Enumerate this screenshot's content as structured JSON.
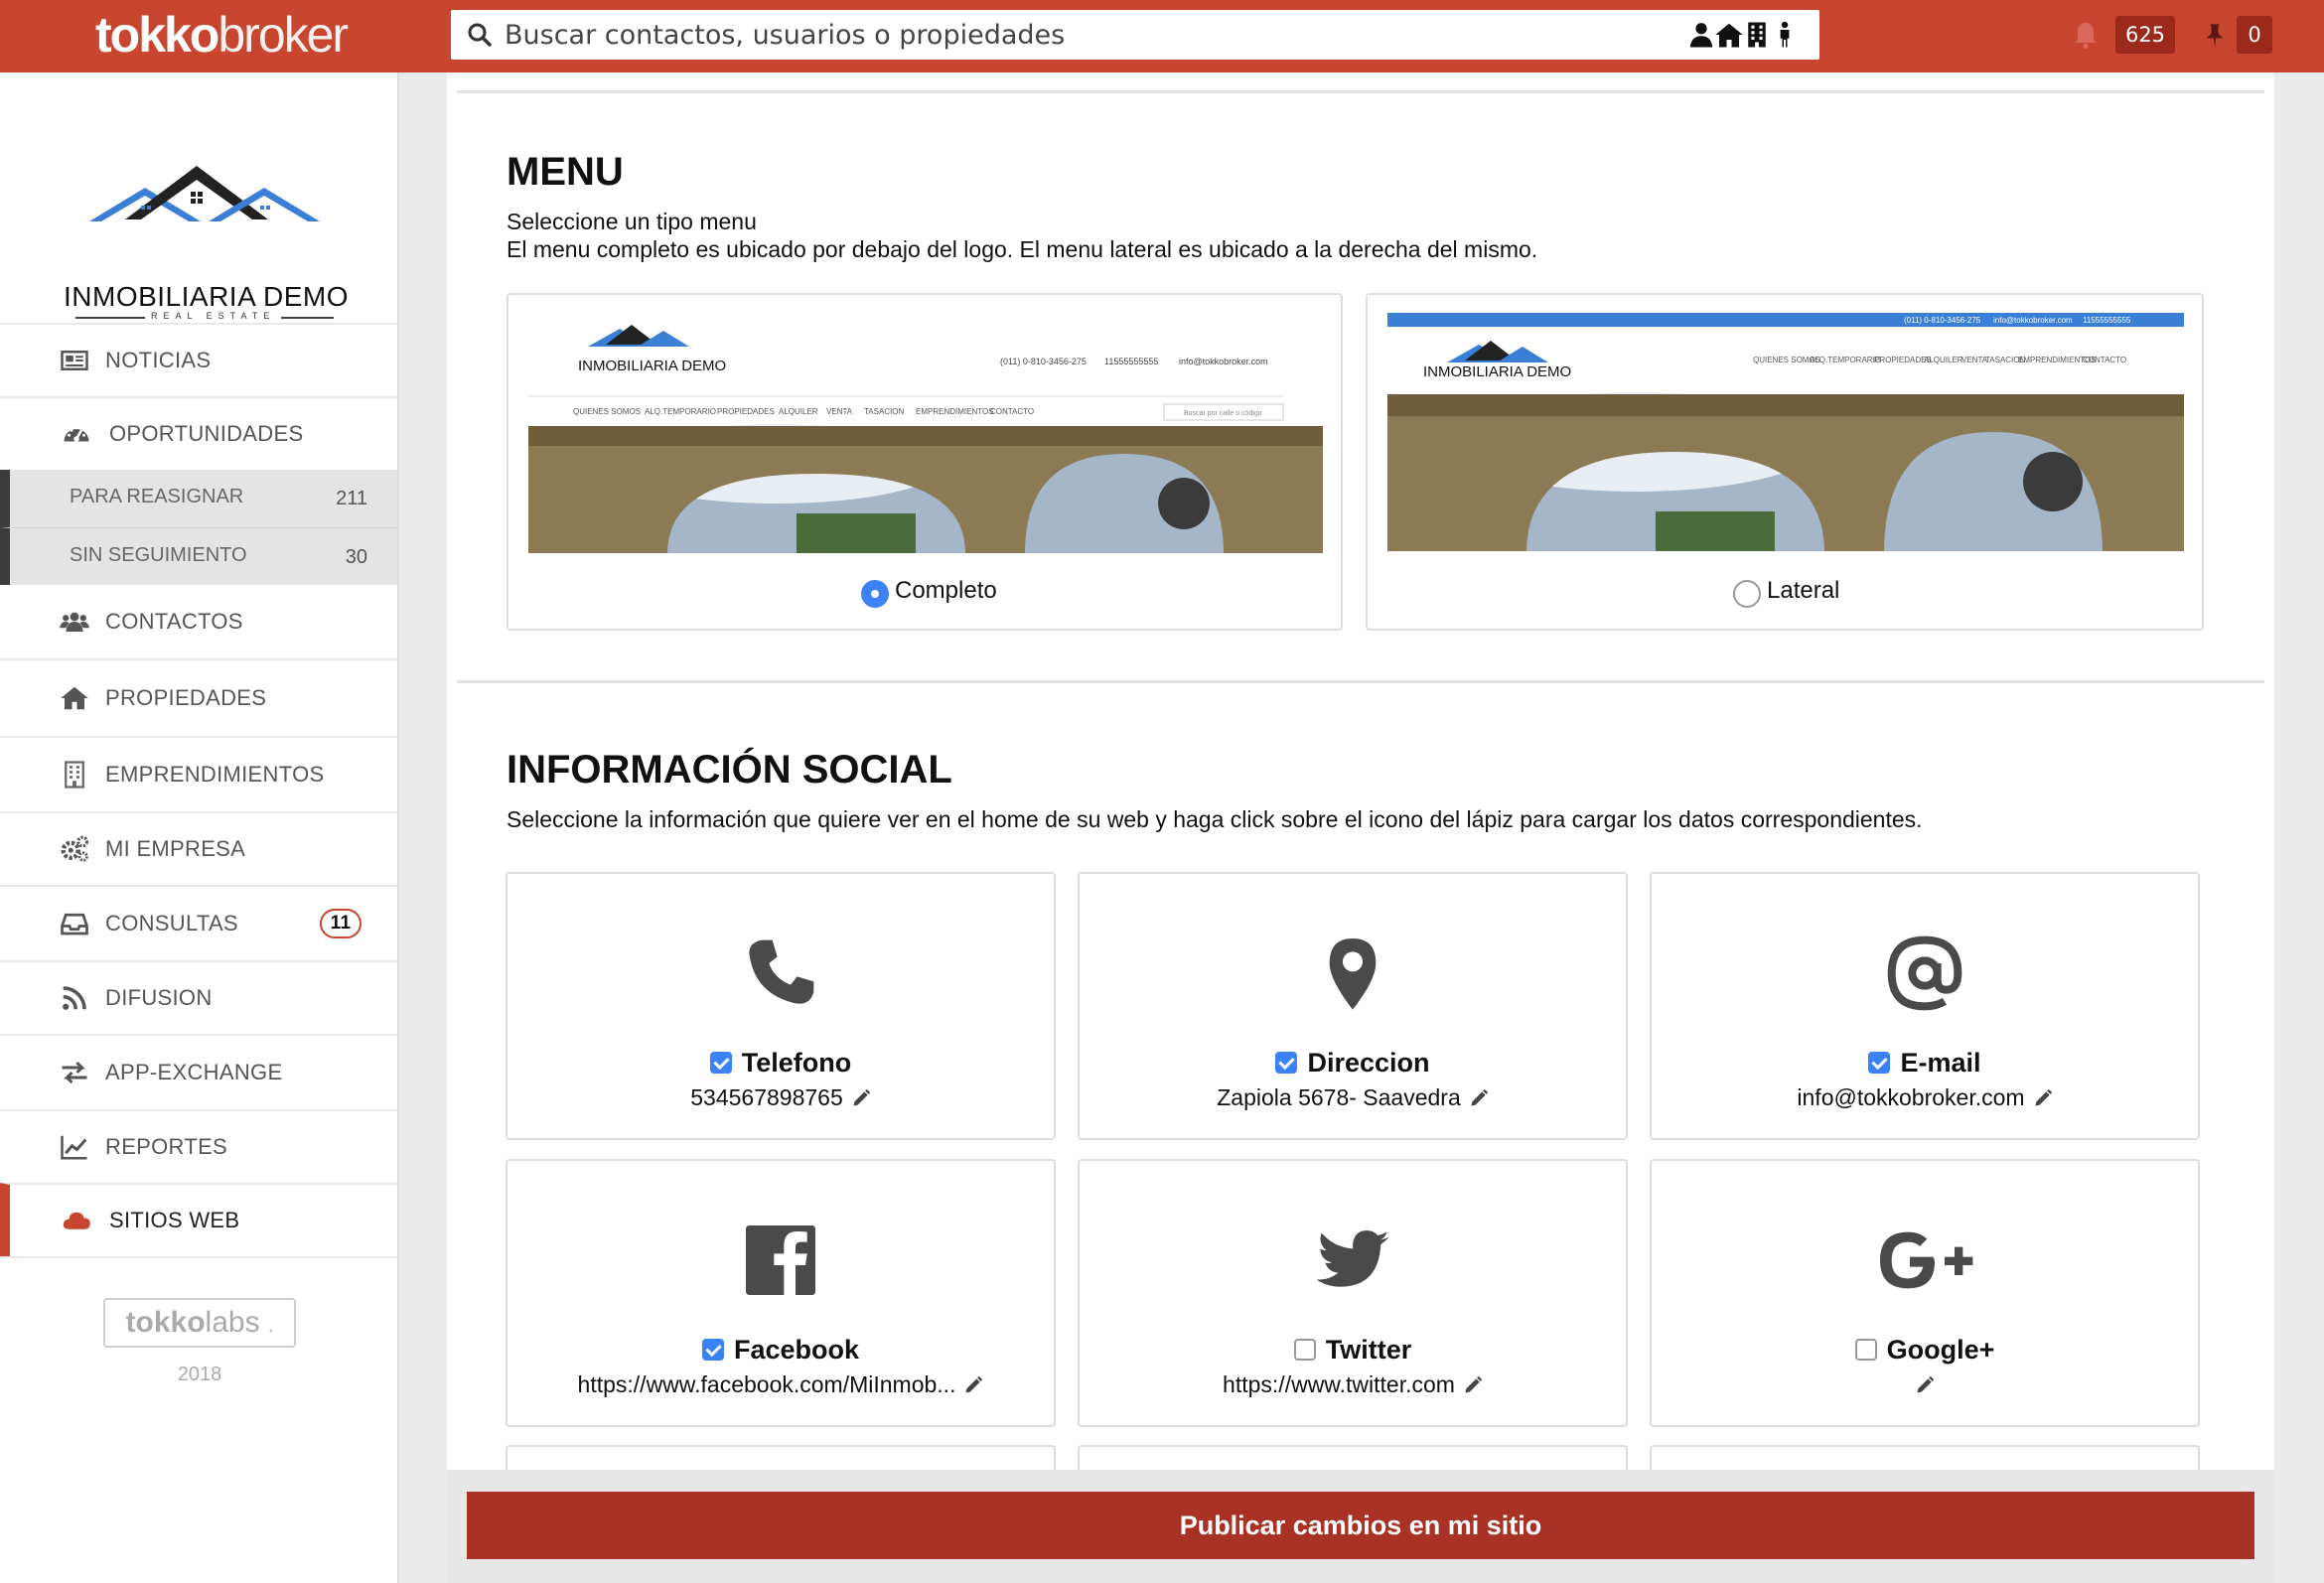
{
  "brand": {
    "part1": "tokko",
    "part2": "broker"
  },
  "search": {
    "placeholder": "Buscar contactos, usuarios o propiedades"
  },
  "top_badges": {
    "notifications": "625",
    "pinned": "0"
  },
  "company": {
    "name": "INMOBILIARIA DEMO",
    "tagline": "REAL ESTATE"
  },
  "sidebar": {
    "items": [
      {
        "label": "NOTICIAS",
        "icon": "newspaper-icon"
      },
      {
        "label": "OPORTUNIDADES",
        "icon": "dashboard-icon"
      },
      {
        "label": "CONTACTOS",
        "icon": "users-icon"
      },
      {
        "label": "PROPIEDADES",
        "icon": "home-icon"
      },
      {
        "label": "EMPRENDIMIENTOS",
        "icon": "building-icon"
      },
      {
        "label": "MI EMPRESA",
        "icon": "gears-icon"
      },
      {
        "label": "CONSULTAS",
        "icon": "inbox-icon",
        "badge": "11"
      },
      {
        "label": "DIFUSION",
        "icon": "rss-icon"
      },
      {
        "label": "APP-EXCHANGE",
        "icon": "exchange-icon"
      },
      {
        "label": "REPORTES",
        "icon": "chart-icon"
      },
      {
        "label": "SITIOS WEB",
        "icon": "cloud-icon"
      }
    ],
    "subitems": [
      {
        "label": "PARA REASIGNAR",
        "count": "211"
      },
      {
        "label": "SIN SEGUIMIENTO",
        "count": "30"
      }
    ],
    "footer": {
      "logo": "tokko",
      "logo2": "labs",
      "year": ". 2018"
    }
  },
  "menu_section": {
    "title": "MENU",
    "line1": "Seleccione un tipo menu",
    "line2": "El menu completo es ubicado por debajo del logo. El menu lateral es ubicado a la derecha del mismo.",
    "options": [
      {
        "label": "Completo",
        "selected": true
      },
      {
        "label": "Lateral",
        "selected": false
      }
    ],
    "preview": {
      "phone_line": "(011) 0-810-3456-275",
      "whatsapp": "11555555555",
      "email": "info@tokkobroker.com",
      "nav": [
        "QUIENES SOMOS",
        "ALQ.TEMPORARIO",
        "PROPIEDADES",
        "ALQUILER",
        "VENTA",
        "TASACION",
        "EMPRENDIMIENTOS",
        "CONTACTO"
      ],
      "search_hint": "Buscar por calle o código"
    }
  },
  "social_section": {
    "title": "INFORMACIÓN SOCIAL",
    "description": "Seleccione la información que quiere ver en el home de su web y haga click sobre el icono del lápiz para cargar los datos correspondientes.",
    "cards": [
      {
        "label": "Telefono",
        "value": "534567898765",
        "checked": true,
        "icon": "phone-icon"
      },
      {
        "label": "Direccion",
        "value": "Zapiola 5678- Saavedra",
        "checked": true,
        "icon": "map-marker-icon"
      },
      {
        "label": "E-mail",
        "value": "info@tokkobroker.com",
        "checked": true,
        "icon": "at-icon"
      },
      {
        "label": "Facebook",
        "value": "https://www.facebook.com/MiInmob...",
        "checked": true,
        "icon": "facebook-icon"
      },
      {
        "label": "Twitter",
        "value": "https://www.twitter.com",
        "checked": false,
        "icon": "twitter-icon"
      },
      {
        "label": "Google+",
        "value": "",
        "checked": false,
        "icon": "google-plus-icon"
      }
    ]
  },
  "publish": {
    "label": "Publicar cambios en mi sitio"
  },
  "colors": {
    "brand": "#c8452f",
    "publish": "#a93226",
    "check": "#3b82f6"
  }
}
